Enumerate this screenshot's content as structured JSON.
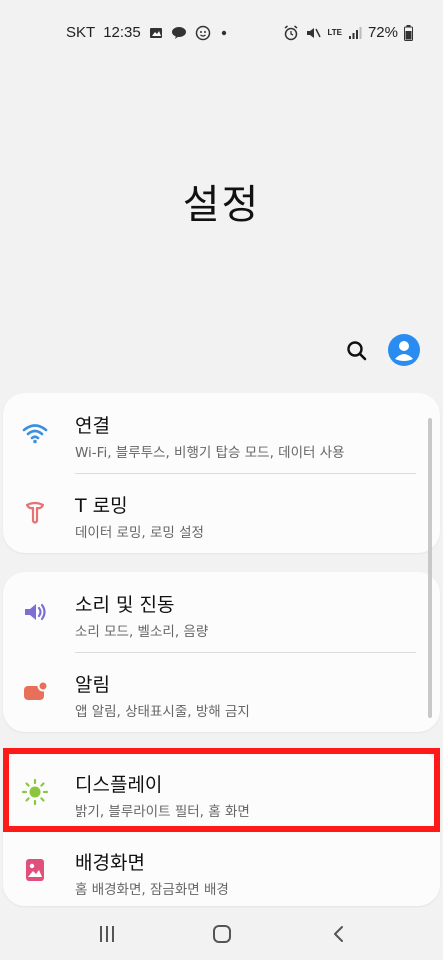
{
  "status_bar": {
    "carrier": "SKT",
    "time": "12:35",
    "battery": "72%",
    "icons_left": [
      "image-icon",
      "chat-icon",
      "smile-icon",
      "dot-icon"
    ],
    "icons_right": [
      "alarm-icon",
      "mute-icon",
      "lte-icon",
      "signal-icon",
      "battery-icon"
    ],
    "lte_label": "LTE"
  },
  "page": {
    "title": "설정"
  },
  "sections": [
    {
      "items": [
        {
          "title": "연결",
          "subtitle": "Wi-Fi, 블루투스, 비행기 탑승 모드, 데이터 사용",
          "icon": "wifi-icon",
          "color": "#3d8fe0"
        },
        {
          "title": "T 로밍",
          "subtitle": "데이터 로밍, 로밍 설정",
          "icon": "roaming-icon",
          "color": "#e57373"
        }
      ]
    },
    {
      "items": [
        {
          "title": "소리 및 진동",
          "subtitle": "소리 모드, 벨소리, 음량",
          "icon": "volume-icon",
          "color": "#7b6fd6"
        },
        {
          "title": "알림",
          "subtitle": "앱 알림, 상태표시줄, 방해 금지",
          "icon": "notification-icon",
          "color": "#e8705a"
        }
      ]
    },
    {
      "items": [
        {
          "title": "디스플레이",
          "subtitle": "밝기, 블루라이트 필터, 홈 화면",
          "icon": "brightness-icon",
          "color": "#8cc63f",
          "highlighted": true
        },
        {
          "title": "배경화면",
          "subtitle": "홈 배경화면, 잠금화면 배경",
          "icon": "wallpaper-icon",
          "color": "#e0507a"
        }
      ]
    }
  ],
  "highlight_color": "#ff1a1a",
  "nav": {
    "buttons": [
      "recents-icon",
      "home-icon",
      "back-icon"
    ]
  }
}
